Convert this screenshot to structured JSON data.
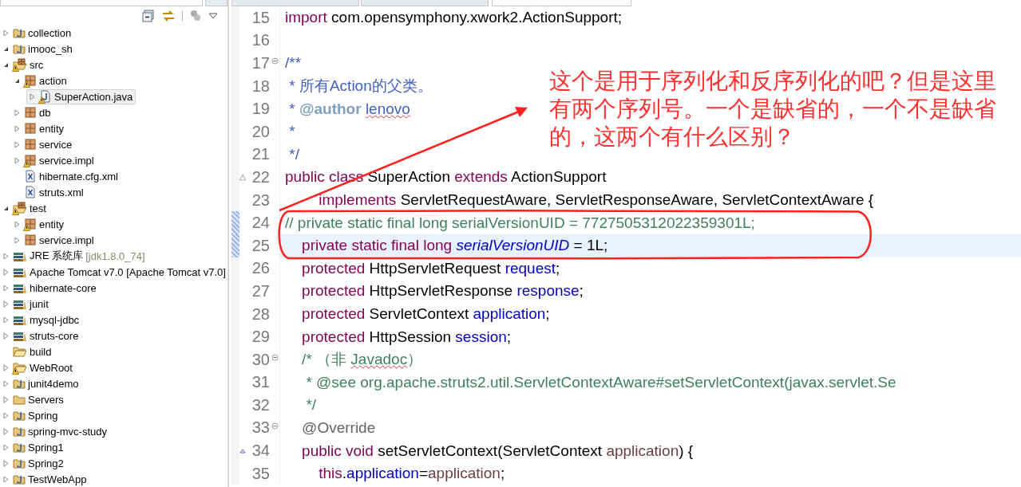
{
  "explorer": {
    "tree": [
      {
        "label": "collection",
        "kind": "project",
        "warning": false,
        "selected": false,
        "expanded": false
      },
      {
        "label": "imooc_sh",
        "kind": "project",
        "warning": false,
        "selected": false,
        "expanded": true,
        "children": [
          {
            "label": "src",
            "kind": "source-folder",
            "warning": true,
            "selected": false,
            "expanded": true,
            "children": [
              {
                "label": "action",
                "kind": "package",
                "warning": true,
                "selected": false,
                "expanded": true,
                "children": [
                  {
                    "label": "SuperAction.java",
                    "kind": "java-file",
                    "warning": true,
                    "selected": true,
                    "expanded": false
                  }
                ]
              },
              {
                "label": "db",
                "kind": "package",
                "warning": false,
                "selected": false,
                "expanded": false
              },
              {
                "label": "entity",
                "kind": "package",
                "warning": false,
                "selected": false,
                "expanded": false
              },
              {
                "label": "service",
                "kind": "package",
                "warning": false,
                "selected": false,
                "expanded": false
              },
              {
                "label": "service.impl",
                "kind": "package",
                "warning": true,
                "selected": false,
                "expanded": false
              },
              {
                "label": "hibernate.cfg.xml",
                "kind": "xml-file",
                "warning": false,
                "selected": false
              },
              {
                "label": "struts.xml",
                "kind": "xml-file",
                "warning": false,
                "selected": false
              }
            ]
          },
          {
            "label": "test",
            "kind": "source-folder",
            "warning": true,
            "selected": false,
            "expanded": true,
            "children": [
              {
                "label": "entity",
                "kind": "package",
                "warning": true,
                "selected": false,
                "expanded": false
              },
              {
                "label": "service.impl",
                "kind": "package",
                "warning": false,
                "selected": false,
                "expanded": false
              }
            ]
          },
          {
            "label": "JRE 系统库",
            "decoration": "[jdk1.8.0_74]",
            "kind": "library",
            "warning": false,
            "selected": false,
            "expanded": false
          },
          {
            "label": "Apache Tomcat v7.0 [Apache Tomcat v7.0]",
            "kind": "library",
            "warning": false,
            "selected": false,
            "expanded": false
          },
          {
            "label": "hibernate-core",
            "kind": "library",
            "warning": false,
            "selected": false,
            "expanded": false
          },
          {
            "label": "junit",
            "kind": "library",
            "warning": false,
            "selected": false,
            "expanded": false
          },
          {
            "label": "mysql-jdbc",
            "kind": "library",
            "warning": false,
            "selected": false,
            "expanded": false
          },
          {
            "label": "struts-core",
            "kind": "library",
            "warning": false,
            "selected": false,
            "expanded": false
          },
          {
            "label": "build",
            "kind": "folder",
            "warning": false,
            "selected": false
          },
          {
            "label": "WebRoot",
            "kind": "folder",
            "warning": true,
            "selected": false,
            "expanded": false
          }
        ]
      },
      {
        "label": "junit4demo",
        "kind": "project",
        "warning": false,
        "selected": false,
        "expanded": false
      },
      {
        "label": "Servers",
        "kind": "plain-project",
        "warning": false,
        "selected": false,
        "expanded": false
      },
      {
        "label": "Spring",
        "kind": "project",
        "warning": false,
        "selected": false,
        "expanded": false
      },
      {
        "label": "spring-mvc-study",
        "kind": "project",
        "warning": false,
        "selected": false,
        "expanded": false
      },
      {
        "label": "Spring1",
        "kind": "project",
        "warning": false,
        "selected": false,
        "expanded": false
      },
      {
        "label": "Spring2",
        "kind": "project",
        "warning": false,
        "selected": false,
        "expanded": false
      },
      {
        "label": "TestWebApp",
        "kind": "project",
        "warning": false,
        "selected": false,
        "expanded": false
      }
    ]
  },
  "editor": {
    "tabs": [
      {
        "selected": false
      },
      {
        "selected": false
      },
      {
        "selected": true
      }
    ],
    "lines": [
      {
        "number": "15",
        "foldable": false,
        "warning": false,
        "overrides": false,
        "highlighted": false,
        "changed": false,
        "tokens": [
          {
            "kind": "keyword",
            "text": "import"
          },
          {
            "kind": "plain",
            "text": " com.opensymphony.xwork2.ActionSupport;"
          }
        ]
      },
      {
        "number": "16",
        "foldable": false,
        "warning": false,
        "overrides": false,
        "highlighted": false,
        "changed": false
      },
      {
        "number": "17",
        "foldable": true,
        "warning": false,
        "overrides": false,
        "highlighted": false,
        "changed": false,
        "tokens": [
          {
            "kind": "javadoc",
            "text": "/**"
          }
        ]
      },
      {
        "number": "18",
        "foldable": false,
        "warning": false,
        "overrides": false,
        "highlighted": false,
        "changed": false,
        "tokens": [
          {
            "kind": "javadoc",
            "text": " * 所有Action的父类。"
          }
        ]
      },
      {
        "number": "19",
        "foldable": false,
        "warning": false,
        "overrides": false,
        "highlighted": false,
        "changed": false,
        "tokens": [
          {
            "kind": "javadoc",
            "text": " * "
          },
          {
            "kind": "javadoc-tag",
            "text": "@author "
          },
          {
            "kind": "javadoc",
            "text": "lenovo",
            "misspelled": true
          }
        ]
      },
      {
        "number": "20",
        "foldable": false,
        "warning": false,
        "overrides": false,
        "highlighted": false,
        "changed": false,
        "tokens": [
          {
            "kind": "javadoc",
            "text": " *"
          }
        ]
      },
      {
        "number": "21",
        "foldable": false,
        "warning": false,
        "overrides": false,
        "highlighted": false,
        "changed": false,
        "tokens": [
          {
            "kind": "javadoc",
            "text": " */"
          }
        ]
      },
      {
        "number": "22",
        "foldable": false,
        "warning": true,
        "overrides": false,
        "highlighted": false,
        "changed": false,
        "tokens": [
          {
            "kind": "keyword",
            "text": "public class"
          },
          {
            "kind": "plain",
            "text": " SuperAction "
          },
          {
            "kind": "keyword",
            "text": "extends"
          },
          {
            "kind": "plain",
            "text": " ActionSupport"
          }
        ]
      },
      {
        "number": "23",
        "foldable": false,
        "warning": false,
        "overrides": false,
        "highlighted": false,
        "changed": false,
        "tokens": [
          {
            "kind": "keyword",
            "text": "        implements"
          },
          {
            "kind": "plain",
            "text": " ServletRequestAware, ServletResponseAware, ServletContextAware {"
          }
        ]
      },
      {
        "number": "24",
        "foldable": false,
        "warning": false,
        "overrides": false,
        "highlighted": false,
        "changed": true,
        "tokens": [
          {
            "kind": "comment",
            "text": "// private static final long serialVersionUID = 7727505312022359301L;"
          }
        ]
      },
      {
        "number": "25",
        "foldable": false,
        "warning": false,
        "overrides": false,
        "highlighted": true,
        "changed": true,
        "tokens": [
          {
            "kind": "keyword",
            "text": "    private static final long "
          },
          {
            "kind": "static-field",
            "text": "serialVersionUID"
          },
          {
            "kind": "plain",
            "text": " = 1L;"
          }
        ]
      },
      {
        "number": "26",
        "foldable": false,
        "warning": false,
        "overrides": false,
        "highlighted": false,
        "changed": false,
        "tokens": [
          {
            "kind": "keyword",
            "text": "    protected"
          },
          {
            "kind": "plain",
            "text": " HttpServletRequest "
          },
          {
            "kind": "field",
            "text": "request"
          },
          {
            "kind": "plain",
            "text": ";"
          }
        ]
      },
      {
        "number": "27",
        "foldable": false,
        "warning": false,
        "overrides": false,
        "highlighted": false,
        "changed": false,
        "tokens": [
          {
            "kind": "keyword",
            "text": "    protected"
          },
          {
            "kind": "plain",
            "text": " HttpServletResponse "
          },
          {
            "kind": "field",
            "text": "response"
          },
          {
            "kind": "plain",
            "text": ";"
          }
        ]
      },
      {
        "number": "28",
        "foldable": false,
        "warning": false,
        "overrides": false,
        "highlighted": false,
        "changed": false,
        "tokens": [
          {
            "kind": "keyword",
            "text": "    protected"
          },
          {
            "kind": "plain",
            "text": " ServletContext "
          },
          {
            "kind": "field",
            "text": "application"
          },
          {
            "kind": "plain",
            "text": ";"
          }
        ]
      },
      {
        "number": "29",
        "foldable": false,
        "warning": false,
        "overrides": false,
        "highlighted": false,
        "changed": false,
        "tokens": [
          {
            "kind": "keyword",
            "text": "    protected"
          },
          {
            "kind": "plain",
            "text": " HttpSession "
          },
          {
            "kind": "field",
            "text": "session"
          },
          {
            "kind": "plain",
            "text": ";"
          }
        ]
      },
      {
        "number": "30",
        "foldable": true,
        "warning": false,
        "overrides": false,
        "highlighted": false,
        "changed": false,
        "tokens": [
          {
            "kind": "comment",
            "text": "    /* （非 "
          },
          {
            "kind": "comment",
            "text": "Javadoc",
            "misspelled": true
          },
          {
            "kind": "comment",
            "text": "）"
          }
        ]
      },
      {
        "number": "31",
        "foldable": false,
        "warning": false,
        "overrides": false,
        "highlighted": false,
        "changed": false,
        "tokens": [
          {
            "kind": "comment",
            "text": "     * @see org.apache.struts2.util.ServletContextAware#setServletContext(javax.servlet.Se"
          }
        ]
      },
      {
        "number": "32",
        "foldable": false,
        "warning": false,
        "overrides": false,
        "highlighted": false,
        "changed": false,
        "tokens": [
          {
            "kind": "comment",
            "text": "     */"
          }
        ]
      },
      {
        "number": "33",
        "foldable": true,
        "warning": false,
        "overrides": false,
        "highlighted": false,
        "changed": false,
        "tokens": [
          {
            "kind": "annotation",
            "text": "    @Override"
          }
        ]
      },
      {
        "number": "34",
        "foldable": false,
        "warning": false,
        "overrides": true,
        "highlighted": false,
        "changed": false,
        "tokens": [
          {
            "kind": "keyword",
            "text": "    public void"
          },
          {
            "kind": "plain",
            "text": " setServletContext(ServletContext "
          },
          {
            "kind": "parameter",
            "text": "application"
          },
          {
            "kind": "plain",
            "text": ") {"
          }
        ]
      },
      {
        "number": "35",
        "foldable": false,
        "warning": false,
        "overrides": false,
        "highlighted": false,
        "changed": false,
        "tokens": [
          {
            "kind": "keyword",
            "text": "        this"
          },
          {
            "kind": "plain",
            "text": "."
          },
          {
            "kind": "field",
            "text": "application"
          },
          {
            "kind": "plain",
            "text": "="
          },
          {
            "kind": "parameter",
            "text": "application"
          },
          {
            "kind": "plain",
            "text": ";"
          }
        ]
      }
    ]
  },
  "annotation": {
    "text": "这个是用于序列化和反序列化的吧？但是这里有两个序列号。一个是缺省的，一个不是缺省的，这两个有什么区别？"
  }
}
